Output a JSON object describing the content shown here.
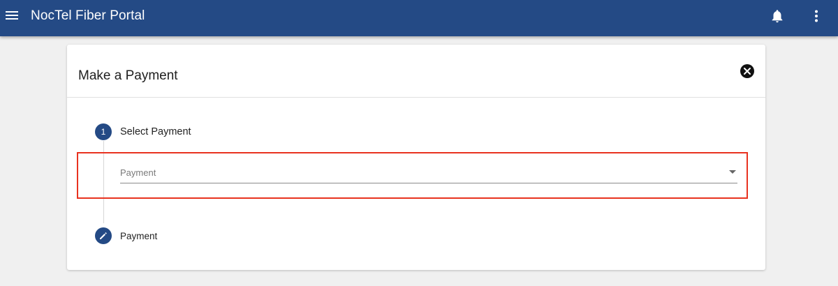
{
  "appbar": {
    "title": "NocTel Fiber Portal",
    "background_color": "#244a85",
    "icons": {
      "menu": "menu-icon",
      "notifications": "bell-icon",
      "more": "more-vert-icon"
    }
  },
  "dialog": {
    "title": "Make a Payment",
    "close_icon": "close-circle-icon",
    "steps": [
      {
        "marker": "1",
        "label": "Select Payment",
        "field": {
          "placeholder": "Payment",
          "value": ""
        }
      },
      {
        "marker_icon": "pencil-icon",
        "label": "Payment"
      }
    ]
  },
  "colors": {
    "accent": "#244a85",
    "highlight": "#e8321f",
    "page_background": "#f0f0f0"
  }
}
